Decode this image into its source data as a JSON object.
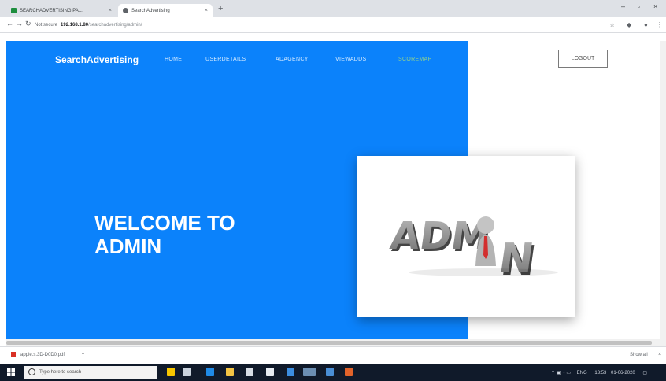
{
  "browser": {
    "tabs": [
      {
        "label": "SEARCHADVERTISING PA...",
        "active": false
      },
      {
        "label": "SearchAdvertising",
        "active": true
      }
    ],
    "omnibox": {
      "security": "Not secure",
      "host": "192.168.1.80",
      "path": "/searchadvertising/admin/"
    }
  },
  "site": {
    "brand": "SearchAdvertising",
    "nav": [
      {
        "label": "HOME",
        "active": false
      },
      {
        "label": "USERDETAILS",
        "active": false
      },
      {
        "label": "ADAGENCY",
        "active": false
      },
      {
        "label": "VIEWADDS",
        "active": false
      },
      {
        "label": "SCOREMAP",
        "active": true
      }
    ],
    "logout_label": "LOGOUT",
    "welcome_line1": "WELCOME TO",
    "welcome_line2": "ADMIN",
    "hero_image_text": "ADMIN"
  },
  "downloads": {
    "item": "apple.s.3D-D0D0.pdf",
    "show_all": "Show all"
  },
  "taskbar": {
    "search_placeholder": "Type here to search",
    "clock": "13:53",
    "date": "01-06-2020",
    "lang": "ENG"
  },
  "colors": {
    "hero": "#0b82fb",
    "active_nav": "#8fd18f"
  }
}
